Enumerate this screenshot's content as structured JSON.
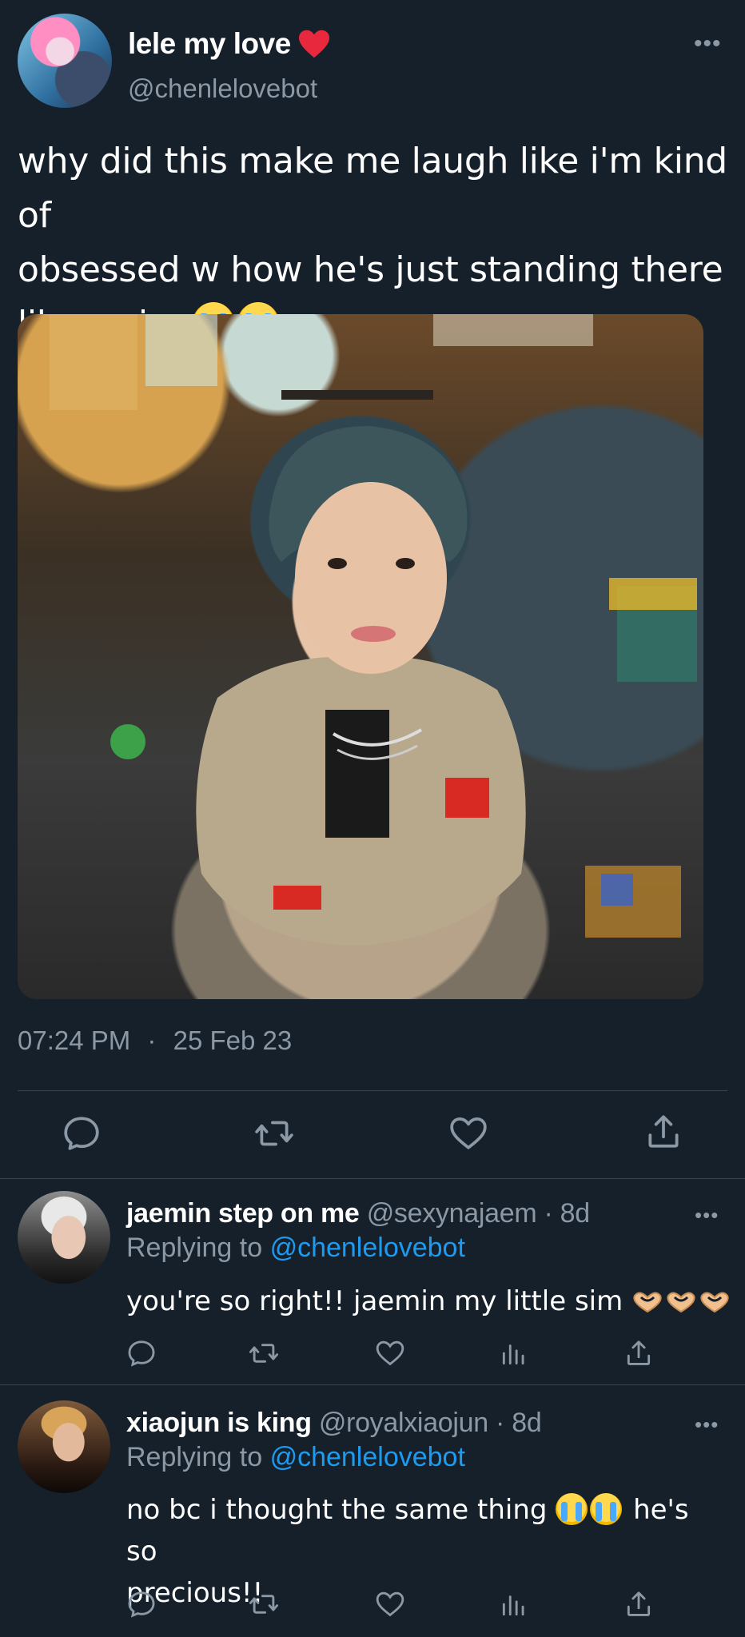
{
  "tweet": {
    "display_name": "lele my love",
    "handle": "@chenlelovebot",
    "more_icon": "more-horizontal-icon",
    "text_line1": "why did this make me laugh like i'm kind of",
    "text_line2": "obsessed w how he's just standing there",
    "text_line3": "like a sim",
    "time": "07:24 PM",
    "separator": "·",
    "date": "25 Feb 23",
    "actions": [
      "reply-icon",
      "retweet-icon",
      "like-icon",
      "share-icon"
    ]
  },
  "replies": [
    {
      "display_name": "jaemin step on me",
      "handle": "@sexynajaem",
      "age": "· 8d",
      "replying_label": "Replying to",
      "replying_handle": "@chenlelovebot",
      "text": "you're so right!! jaemin my little sim"
    },
    {
      "display_name": "xiaojun is king",
      "handle": "@royalxiaojun",
      "age": "· 8d",
      "replying_label": "Replying to",
      "replying_handle": "@chenlelovebot",
      "text_part1": "no bc i thought the same thing",
      "text_part2": "he's so",
      "text_line2": "precious!!"
    }
  ],
  "colors": {
    "background": "#15202b",
    "secondary_text": "#8b98a5",
    "link": "#1d9bf0",
    "divider": "#38444d"
  }
}
